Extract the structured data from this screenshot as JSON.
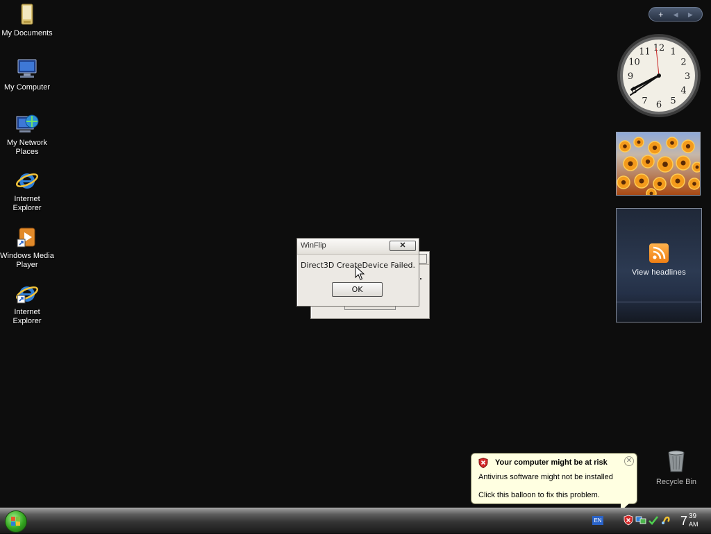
{
  "desktop": {
    "icons": [
      {
        "label_line1": "My Documents",
        "label_line2": ""
      },
      {
        "label_line1": "My Computer",
        "label_line2": ""
      },
      {
        "label_line1": "My Network",
        "label_line2": "Places"
      },
      {
        "label_line1": "Internet",
        "label_line2": "Explorer"
      },
      {
        "label_line1": "Windows Media",
        "label_line2": "Player"
      },
      {
        "label_line1": "Internet",
        "label_line2": "Explorer"
      }
    ],
    "recycle_bin_label": "Recycle Bin"
  },
  "sidebar": {
    "add_glyph": "+",
    "prev_glyph": "◀",
    "next_glyph": "▶",
    "clock_numbers": [
      "12",
      "1",
      "2",
      "3",
      "4",
      "5",
      "6",
      "7",
      "8",
      "9",
      "10",
      "11"
    ],
    "feeds_label": "View headlines"
  },
  "dialog": {
    "title": "WinFlip",
    "close_glyph": "✕",
    "message": "Direct3D CreateDevice Failed.",
    "ok_label": "OK"
  },
  "balloon": {
    "title": "Your computer might be at risk",
    "close_glyph": "✕",
    "line1": "Antivirus software might not be installed",
    "line2": "Click this balloon to fix this problem."
  },
  "taskbar": {
    "language": "EN",
    "clock_hour": "7",
    "clock_minute": "39",
    "clock_ampm": "AM"
  }
}
